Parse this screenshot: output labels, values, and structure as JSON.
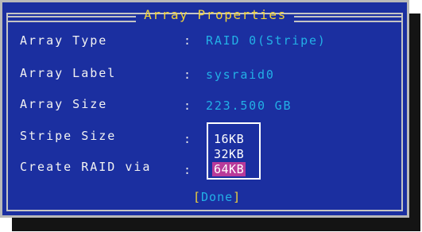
{
  "dialog": {
    "title": "Array Properties"
  },
  "rows": [
    {
      "label": "Array Type",
      "colon": ":",
      "value": "RAID 0(Stripe)"
    },
    {
      "label": "Array Label",
      "colon": ":",
      "value": "sysraid0"
    },
    {
      "label": "Array Size",
      "colon": ":",
      "value": "223.500 GB"
    },
    {
      "label": "Stripe Size",
      "colon": ":",
      "value": ""
    },
    {
      "label": "Create RAID via",
      "colon": ":",
      "value": ""
    }
  ],
  "stripe_size_dropdown": {
    "options": [
      "16KB",
      "32KB",
      "64KB"
    ],
    "selected": "64KB"
  },
  "done_button": {
    "open_bracket": "[",
    "label": "Done",
    "close_bracket": "]"
  },
  "colors": {
    "background": "#1b2fa0",
    "value_text": "#23b0e6",
    "title_text": "#f2d33a",
    "selection": "#b93a9a"
  }
}
